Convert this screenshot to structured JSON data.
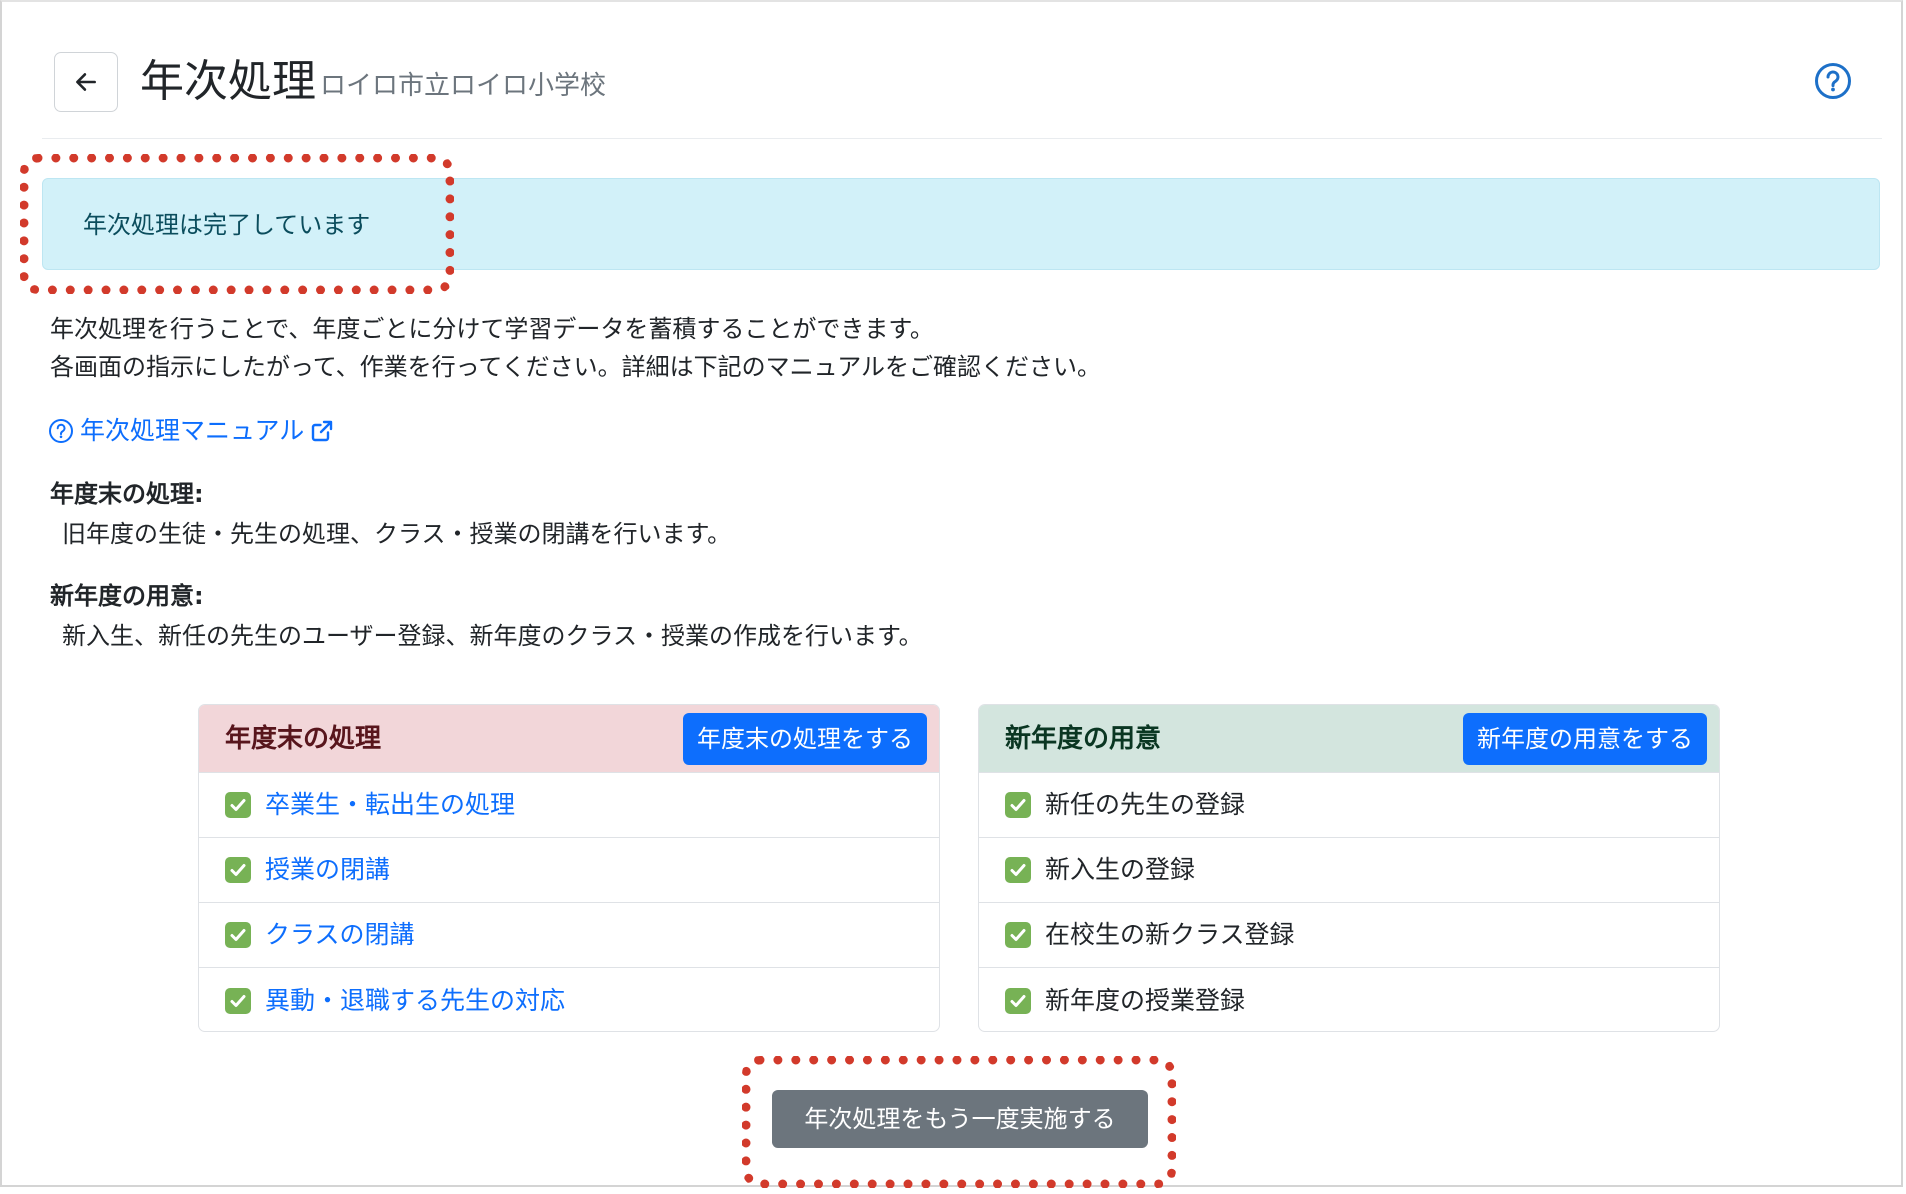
{
  "header": {
    "title": "年次処理",
    "school_name": "ロイロ市立ロイロ小学校",
    "back_icon": "arrow-left-icon",
    "help_icon": "question-circle-icon"
  },
  "alert": {
    "text": "年次処理は完了しています"
  },
  "description": {
    "line1": "年次処理を行うことで、年度ごとに分けて学習データを蓄積することができます。",
    "line2": "各画面の指示にしたがって、作業を行ってください。詳細は下記のマニュアルをご確認ください。"
  },
  "manual_link": {
    "label": "年次処理マニュアル",
    "icon": "question-circle-icon",
    "external_icon": "external-link-icon"
  },
  "sections": {
    "end_of_year": {
      "heading": "年度末の処理:",
      "body": "旧年度の生徒・先生の処理、クラス・授業の閉講を行います。"
    },
    "new_year": {
      "heading": "新年度の用意:",
      "body": "新入生、新任の先生のユーザー登録、新年度のクラス・授業の作成を行います。"
    }
  },
  "cards": {
    "end_of_year": {
      "title": "年度末の処理",
      "button": "年度末の処理をする",
      "items": [
        "卒業生・転出生の処理",
        "授業の閉講",
        "クラスの閉講",
        "異動・退職する先生の対応"
      ]
    },
    "new_year": {
      "title": "新年度の用意",
      "button": "新年度の用意をする",
      "items": [
        "新任の先生の登録",
        "新入生の登録",
        "在校生の新クラス登録",
        "新年度の授業登録"
      ]
    }
  },
  "redo_button": "年次処理をもう一度実施する",
  "colors": {
    "primary": "#0d6efd",
    "secondary": "#6c757d",
    "info_bg": "#d2f1f9",
    "danger_bg": "#f2d6d9",
    "success_bg": "#d3e5de",
    "highlight": "#d23a2b",
    "check": "#77b255"
  }
}
